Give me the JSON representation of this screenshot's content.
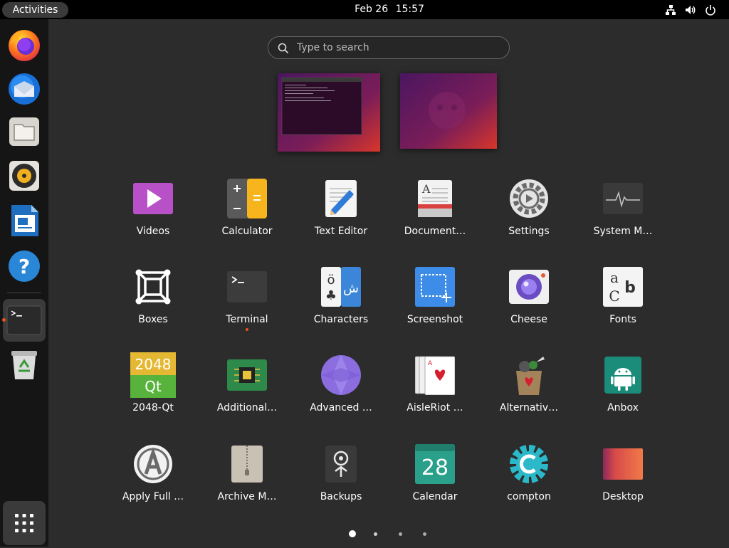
{
  "topbar": {
    "activities_label": "Activities",
    "date": "Feb 26",
    "time": "15:57",
    "network_icon": "network-icon",
    "volume_icon": "volume-icon",
    "power_icon": "power-icon"
  },
  "dock": {
    "items": [
      {
        "name": "firefox",
        "icon": "firefox-icon"
      },
      {
        "name": "thunderbird",
        "icon": "thunderbird-icon"
      },
      {
        "name": "files",
        "icon": "files-icon"
      },
      {
        "name": "rhythmbox",
        "icon": "rhythmbox-icon"
      },
      {
        "name": "libreoffice-writer",
        "icon": "writer-icon"
      },
      {
        "name": "help",
        "icon": "help-icon"
      },
      {
        "name": "terminal",
        "icon": "terminal-icon",
        "active": true,
        "running": true
      },
      {
        "name": "trash",
        "icon": "trash-icon"
      }
    ],
    "show_apps_icon": "grid-icon"
  },
  "search": {
    "placeholder": "Type to search"
  },
  "apps": [
    {
      "label": "Videos",
      "icon": "videos-icon"
    },
    {
      "label": "Calculator",
      "icon": "calculator-icon"
    },
    {
      "label": "Text Editor",
      "icon": "text-editor-icon"
    },
    {
      "label": "Document…",
      "icon": "document-viewer-icon"
    },
    {
      "label": "Settings",
      "icon": "settings-icon"
    },
    {
      "label": "System M…",
      "icon": "system-monitor-icon"
    },
    {
      "label": "Boxes",
      "icon": "boxes-icon"
    },
    {
      "label": "Terminal",
      "icon": "terminal-icon",
      "running": true
    },
    {
      "label": "Characters",
      "icon": "characters-icon"
    },
    {
      "label": "Screenshot",
      "icon": "screenshot-icon"
    },
    {
      "label": "Cheese",
      "icon": "cheese-icon"
    },
    {
      "label": "Fonts",
      "icon": "fonts-icon"
    },
    {
      "label": "2048-Qt",
      "icon": "2048-icon"
    },
    {
      "label": "Additional…",
      "icon": "additional-drivers-icon"
    },
    {
      "label": "Advanced …",
      "icon": "advanced-icon"
    },
    {
      "label": "AisleRiot …",
      "icon": "aisleriot-icon"
    },
    {
      "label": "Alternativ…",
      "icon": "alternative-icon"
    },
    {
      "label": "Anbox",
      "icon": "anbox-icon"
    },
    {
      "label": "Apply Full …",
      "icon": "apply-full-upgrade-icon"
    },
    {
      "label": "Archive M…",
      "icon": "archive-manager-icon"
    },
    {
      "label": "Backups",
      "icon": "backups-icon"
    },
    {
      "label": "Calendar",
      "icon": "calendar-icon"
    },
    {
      "label": "compton",
      "icon": "compton-icon"
    },
    {
      "label": "Desktop",
      "icon": "desktop-icon"
    }
  ],
  "icon_text": {
    "2048_top": "2048",
    "2048_bottom": "Qt",
    "calendar_day": "28",
    "characters_latin": "ö",
    "characters_arabic": "ش",
    "fonts_a": "a",
    "fonts_b": "b",
    "fonts_c": "C"
  },
  "pagination": {
    "pages": 4,
    "current": 1
  },
  "colors": {
    "accent": "#e95420",
    "panel": "#000000",
    "dock": "#151515",
    "background": "#2c2c2c"
  }
}
